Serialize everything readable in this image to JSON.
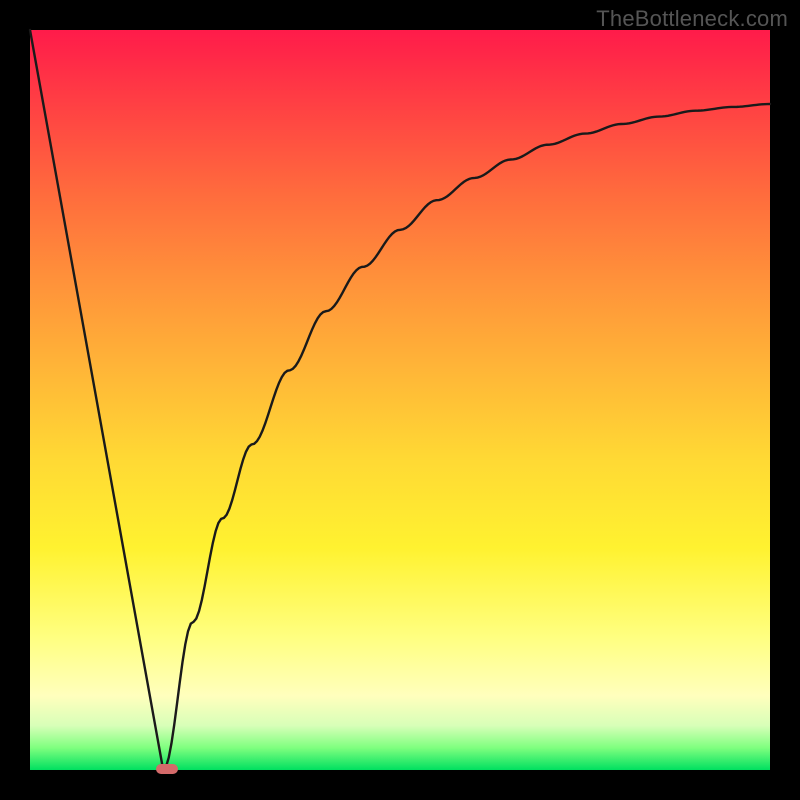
{
  "watermark": "TheBottleneck.com",
  "chart_data": {
    "type": "line",
    "title": "",
    "xlabel": "",
    "ylabel": "",
    "xlim": [
      0,
      100
    ],
    "ylim": [
      0,
      100
    ],
    "grid": false,
    "legend": false,
    "series": [
      {
        "name": "left-branch",
        "x": [
          0,
          18
        ],
        "values": [
          100,
          0
        ]
      },
      {
        "name": "right-branch",
        "x": [
          18,
          22,
          26,
          30,
          35,
          40,
          45,
          50,
          55,
          60,
          65,
          70,
          75,
          80,
          85,
          90,
          95,
          100
        ],
        "values": [
          0,
          20,
          34,
          44,
          54,
          62,
          68,
          73,
          77,
          80,
          82.5,
          84.5,
          86,
          87.3,
          88.3,
          89.1,
          89.6,
          90
        ]
      }
    ],
    "annotations": [
      {
        "name": "vertex-marker",
        "x_range": [
          17,
          20
        ],
        "y": 0,
        "color": "#d46a6a"
      }
    ]
  },
  "colors": {
    "frame": "#000000",
    "curve": "#1a1a1a",
    "marker": "#d46a6a"
  }
}
